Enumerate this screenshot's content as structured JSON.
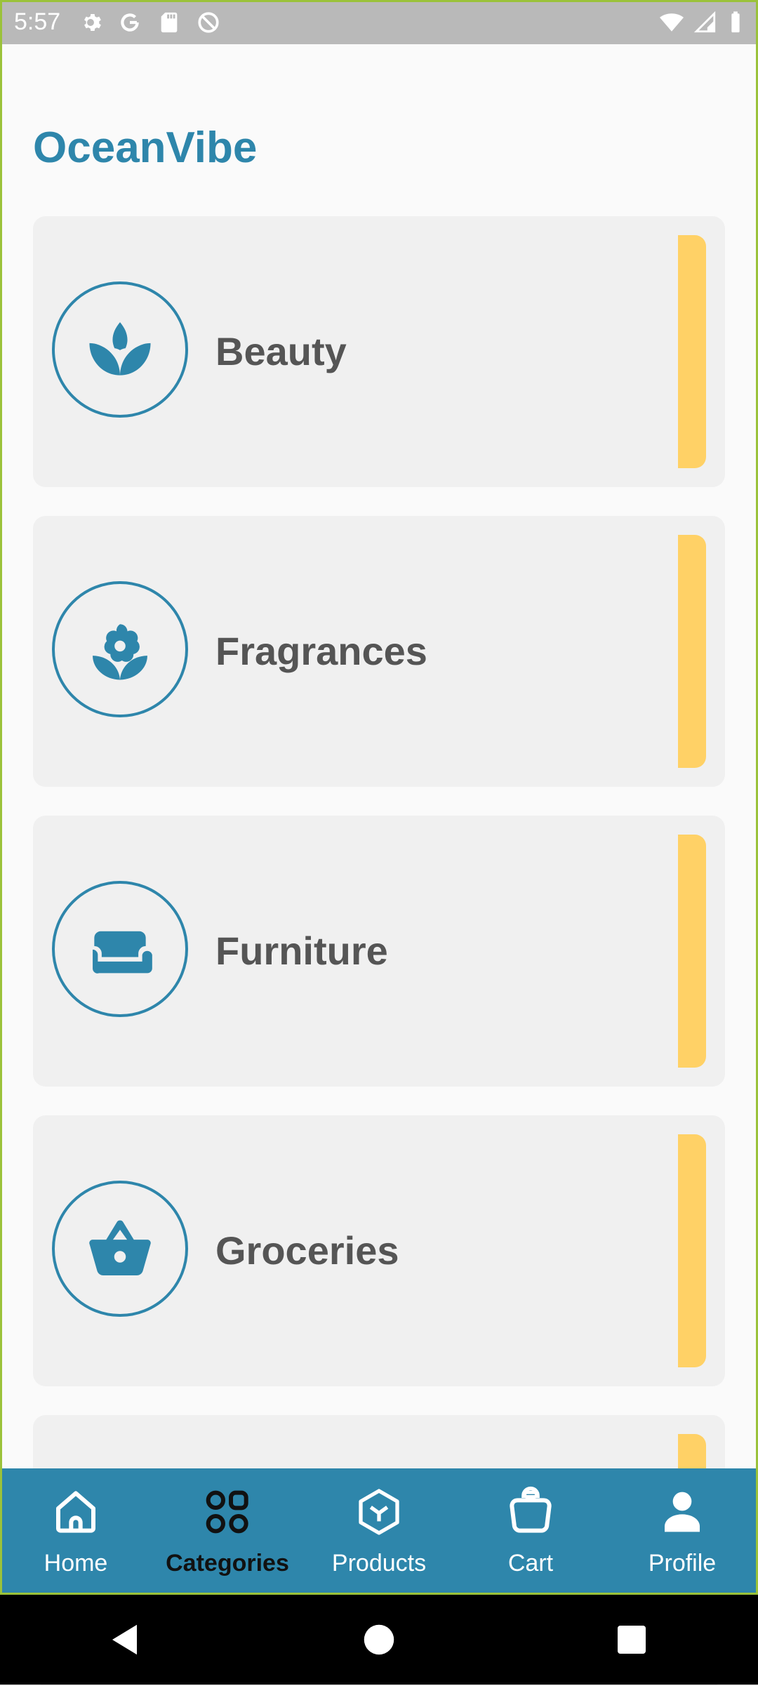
{
  "status_bar": {
    "time": "5:57",
    "left_icons": [
      "settings-icon",
      "google-icon",
      "sd-card-icon",
      "do-not-disturb-icon"
    ],
    "right_icons": [
      "wifi-icon",
      "cell-signal-icon",
      "battery-icon"
    ]
  },
  "app": {
    "title": "OceanVibe",
    "primary_color": "#2e86ab",
    "accent_color": "#ffd166"
  },
  "categories": [
    {
      "label": "Beauty",
      "icon": "lotus-icon"
    },
    {
      "label": "Fragrances",
      "icon": "flower-icon"
    },
    {
      "label": "Furniture",
      "icon": "sofa-icon"
    },
    {
      "label": "Groceries",
      "icon": "basket-icon"
    },
    {
      "label": "",
      "icon": ""
    }
  ],
  "bottom_nav": {
    "items": [
      {
        "label": "Home",
        "icon": "home-icon",
        "active": false
      },
      {
        "label": "Categories",
        "icon": "categories-icon",
        "active": true
      },
      {
        "label": "Products",
        "icon": "products-icon",
        "active": false
      },
      {
        "label": "Cart",
        "icon": "cart-icon",
        "active": false
      },
      {
        "label": "Profile",
        "icon": "profile-icon",
        "active": false
      }
    ]
  },
  "system_nav": {
    "buttons": [
      "back-icon",
      "home-circle-icon",
      "recents-icon"
    ]
  }
}
